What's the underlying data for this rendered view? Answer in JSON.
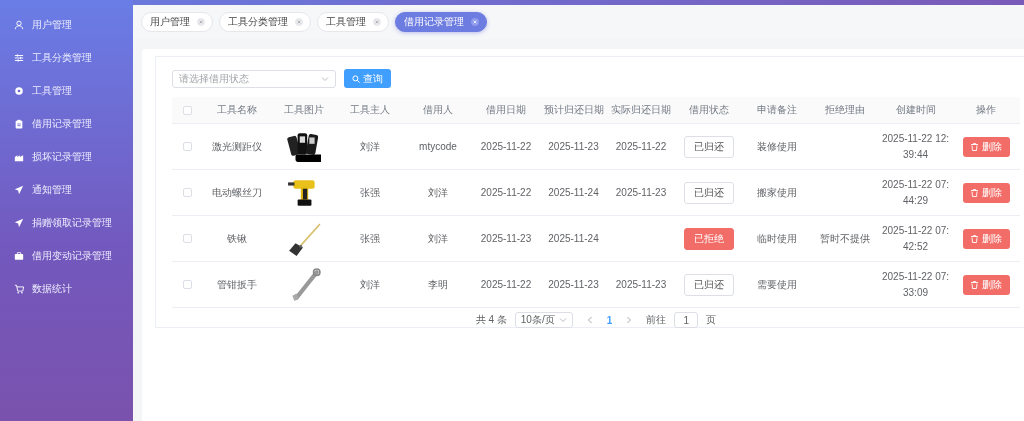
{
  "sidebar": {
    "items": [
      {
        "label": "用户管理"
      },
      {
        "label": "工具分类管理"
      },
      {
        "label": "工具管理"
      },
      {
        "label": "借用记录管理"
      },
      {
        "label": "损坏记录管理"
      },
      {
        "label": "通知管理"
      },
      {
        "label": "捐赠领取记录管理"
      },
      {
        "label": "借用变动记录管理"
      },
      {
        "label": "数据统计"
      }
    ]
  },
  "tabs": [
    {
      "label": "用户管理",
      "selected": false
    },
    {
      "label": "工具分类管理",
      "selected": false
    },
    {
      "label": "工具管理",
      "selected": false
    },
    {
      "label": "借用记录管理",
      "selected": true
    }
  ],
  "filter": {
    "placeholder": "请选择借用状态",
    "button": "查询"
  },
  "table": {
    "all_checked": false,
    "columns": [
      "工具名称",
      "工具图片",
      "工具主人",
      "借用人",
      "借用日期",
      "预计归还日期",
      "实际归还日期",
      "借用状态",
      "申请备注",
      "拒绝理由",
      "创建时间",
      "操作"
    ],
    "rows": [
      {
        "name": "激光测距仪",
        "owner": "刘洋",
        "borrower": "mtycode",
        "borrow_date": "2025-11-22",
        "expected_return": "2025-11-23",
        "actual_return": "2025-11-22",
        "status": {
          "label": "已归还",
          "kind": "returned"
        },
        "note": "装修使用",
        "created": "2025-11-22 12:39:44",
        "action": "删除",
        "checked": false
      },
      {
        "name": "电动螺丝刀",
        "owner": "张强",
        "borrower": "刘洋",
        "borrow_date": "2025-11-22",
        "expected_return": "2025-11-24",
        "actual_return": "2025-11-23",
        "status": {
          "label": "已归还",
          "kind": "returned"
        },
        "note": "搬家使用",
        "created": "2025-11-22 07:44:29",
        "action": "删除",
        "checked": false
      },
      {
        "name": "铁锹",
        "owner": "张强",
        "borrower": "刘洋",
        "borrow_date": "2025-11-23",
        "expected_return": "2025-11-24",
        "status": {
          "label": "已拒绝",
          "kind": "rejected"
        },
        "note": "临时使用",
        "reason": "暂时不提供",
        "created": "2025-11-22 07:42:52",
        "action": "删除",
        "checked": false
      },
      {
        "name": "管钳扳手",
        "owner": "刘洋",
        "borrower": "李明",
        "borrow_date": "2025-11-22",
        "expected_return": "2025-11-23",
        "actual_return": "2025-11-23",
        "status": {
          "label": "已归还",
          "kind": "returned"
        },
        "note": "需要使用",
        "created": "2025-11-22 07:33:09",
        "action": "删除",
        "checked": false
      }
    ]
  },
  "pagination": {
    "total": "共 4 条",
    "page_size": "10条/页",
    "pages": [
      {
        "label": "1",
        "selected": true
      }
    ],
    "goto_label": "前往",
    "goto_value": "1",
    "goto_suffix": "页"
  }
}
